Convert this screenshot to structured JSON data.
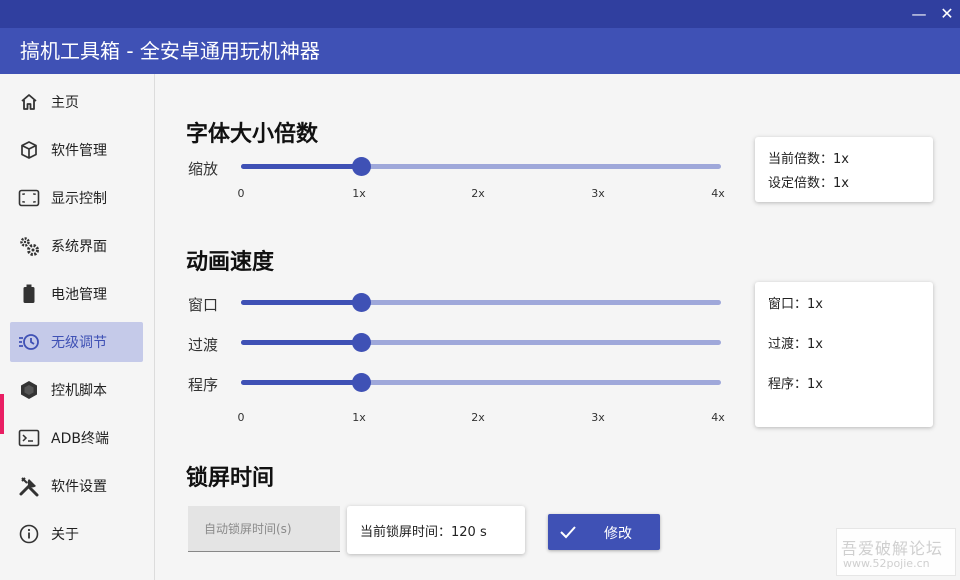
{
  "window": {
    "title": "搞机工具箱 - 全安卓通用玩机神器",
    "minimize_label": "—",
    "close_label": "✕",
    "accent": "#3f51b5",
    "accent_dark": "#303f9f"
  },
  "sidebar": {
    "active_index": 5,
    "active_indicator_color": "#e91e63",
    "items": [
      {
        "label": "主页",
        "icon": "home-icon"
      },
      {
        "label": "软件管理",
        "icon": "package-icon"
      },
      {
        "label": "显示控制",
        "icon": "screen-frame-icon"
      },
      {
        "label": "系统界面",
        "icon": "gears-icon"
      },
      {
        "label": "电池管理",
        "icon": "battery-icon"
      },
      {
        "label": "无级调节",
        "icon": "clock-list-icon"
      },
      {
        "label": "控机脚本",
        "icon": "hexagon-icon"
      },
      {
        "label": "ADB终端",
        "icon": "terminal-icon"
      },
      {
        "label": "软件设置",
        "icon": "tools-icon"
      },
      {
        "label": "关于",
        "icon": "info-icon"
      }
    ]
  },
  "font_scale": {
    "title": "字体大小倍数",
    "slider_label": "缩放",
    "value": 1,
    "ticks": [
      "0",
      "1x",
      "2x",
      "3x",
      "4x"
    ],
    "card": {
      "current": "当前倍数：1x",
      "set": "设定倍数：1x"
    }
  },
  "animation": {
    "title": "动画速度",
    "sliders": [
      {
        "label": "窗口",
        "value": 1
      },
      {
        "label": "过渡",
        "value": 1
      },
      {
        "label": "程序",
        "value": 1
      }
    ],
    "ticks": [
      "0",
      "1x",
      "2x",
      "3x",
      "4x"
    ],
    "card": {
      "window": "窗口：1x",
      "transition": "过渡：1x",
      "program": "程序：1x"
    }
  },
  "lock_screen": {
    "title": "锁屏时间",
    "input_placeholder": "自动锁屏时间(s)",
    "input_value": "",
    "current": "当前锁屏时间：120 s",
    "modify_label": "修改"
  },
  "watermark": {
    "line1": "吾爱破解论坛",
    "line2": "www.52pojie.cn"
  }
}
